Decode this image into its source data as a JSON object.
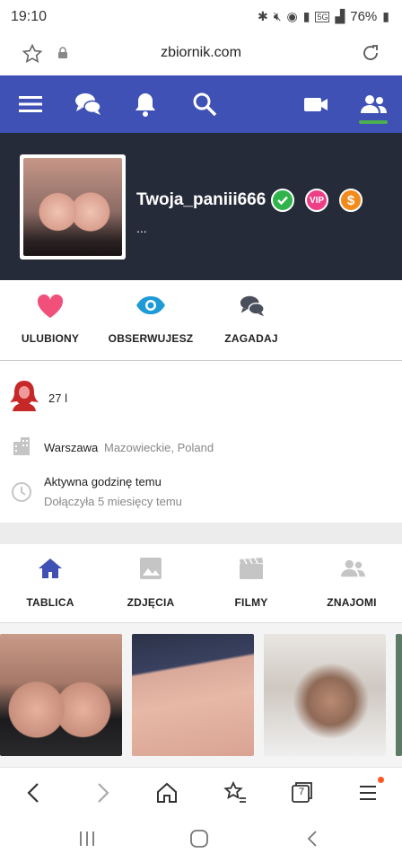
{
  "status_bar": {
    "time": "19:10",
    "battery": "76%",
    "network": "5G"
  },
  "browser": {
    "url": "zbiornik.com",
    "tab_count": "7"
  },
  "colors": {
    "nav_bg": "#3f51b5",
    "header_bg": "#262b3a",
    "active_underline": "#4caf50",
    "heart": "#f1507a",
    "eye": "#1e9bd7",
    "verified": "#2fb34a",
    "vip": "#ec3f86",
    "coin": "#f28a1c"
  },
  "nav": {
    "icons": [
      "menu-icon",
      "chat-icon",
      "bell-icon",
      "search-icon",
      "video-camera-icon",
      "friends-icon"
    ]
  },
  "profile": {
    "username": "Twoja_paniii666",
    "status": "...",
    "vip_label": "VIP",
    "coin_label": "$"
  },
  "actions": [
    {
      "label": "ULUBIONY",
      "icon": "heart-icon"
    },
    {
      "label": "OBSERWUJESZ",
      "icon": "eye-icon"
    },
    {
      "label": "ZAGADAJ",
      "icon": "chat-icon"
    }
  ],
  "info": {
    "age": "27 l",
    "city": "Warszawa",
    "region": "Mazowieckie, Poland",
    "activity": "Aktywna godzinę temu",
    "joined": "Dołączyła 5 miesięcy temu"
  },
  "tabs": [
    {
      "label": "TABLICA",
      "icon": "home-icon"
    },
    {
      "label": "ZDJĘCIA",
      "icon": "image-icon"
    },
    {
      "label": "FILMY",
      "icon": "film-icon"
    },
    {
      "label": "ZNAJOMI",
      "icon": "friends-icon"
    }
  ]
}
